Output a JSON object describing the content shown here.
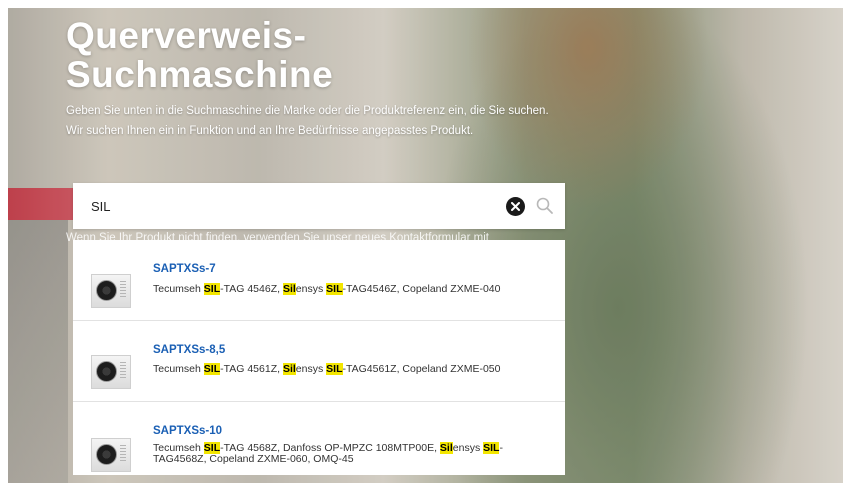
{
  "hero": {
    "title": "Querverweis-Suchmaschine",
    "description": "Geben Sie unten in die Suchmaschine die Marke oder die Produktreferenz ein, die Sie suchen. Wir suchen Ihnen ein in Funktion und an Ihre Bedürfnisse angepasstes Produkt.",
    "partially_hidden_text": "Wenn Sie Ihr Produkt nicht finden, verwenden Sie unser neues Kontaktformular mit"
  },
  "search": {
    "value": "SIL",
    "clear_icon": "close-circle-icon",
    "search_icon": "search-icon"
  },
  "results": [
    {
      "title": "SAPTXSs-7",
      "desc_parts": [
        {
          "t": "Tecumseh ",
          "h": false
        },
        {
          "t": "SIL",
          "h": true
        },
        {
          "t": "-TAG 4546Z, ",
          "h": false
        },
        {
          "t": "Sil",
          "h": true
        },
        {
          "t": "ensys ",
          "h": false
        },
        {
          "t": "SIL",
          "h": true
        },
        {
          "t": "-TAG4546Z, Copeland ZXME-040",
          "h": false
        }
      ]
    },
    {
      "title": "SAPTXSs-8,5",
      "desc_parts": [
        {
          "t": "Tecumseh ",
          "h": false
        },
        {
          "t": "SIL",
          "h": true
        },
        {
          "t": "-TAG 4561Z, ",
          "h": false
        },
        {
          "t": "Sil",
          "h": true
        },
        {
          "t": "ensys ",
          "h": false
        },
        {
          "t": "SIL",
          "h": true
        },
        {
          "t": "-TAG4561Z, Copeland ZXME-050",
          "h": false
        }
      ]
    },
    {
      "title": "SAPTXSs-10",
      "desc_parts": [
        {
          "t": "Tecumseh ",
          "h": false
        },
        {
          "t": "SIL",
          "h": true
        },
        {
          "t": "-TAG 4568Z, Danfoss OP-MPZC 108MTP00E, ",
          "h": false
        },
        {
          "t": "Sil",
          "h": true
        },
        {
          "t": "ensys ",
          "h": false
        },
        {
          "t": "SIL",
          "h": true
        },
        {
          "t": "-TAG4568Z, Copeland ZXME-060, OMQ-45",
          "h": false
        }
      ]
    }
  ],
  "colors": {
    "link": "#1a5fb4",
    "highlight": "#f3e600"
  }
}
